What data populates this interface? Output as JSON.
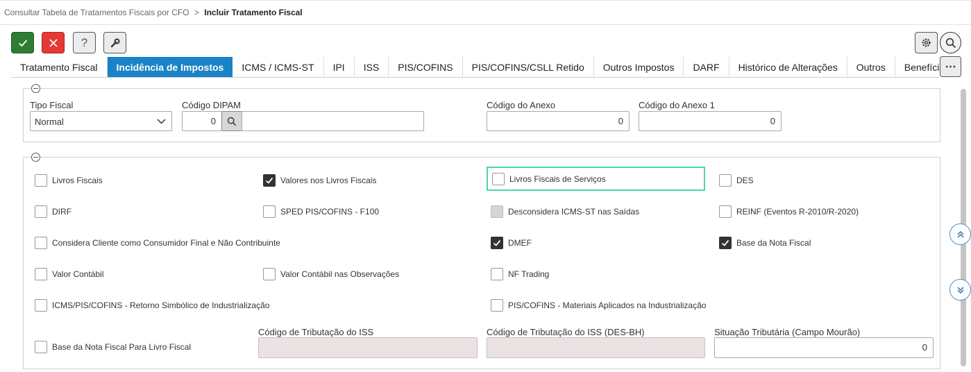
{
  "breadcrumb": {
    "parent": "Consultar Tabela de Tratamentos Fiscais por CFO",
    "separator": ">",
    "current": "Incluir Tratamento Fiscal"
  },
  "toolbar": {
    "confirm_icon": "check-icon",
    "cancel_icon": "close-icon",
    "help_label": "?",
    "tools_icon": "wrench-icon",
    "settings_icon": "gear-icon",
    "search_icon": "search-icon",
    "more_label": "⋯"
  },
  "tabs": [
    {
      "label": "Tratamento Fiscal",
      "active": false
    },
    {
      "label": "Incidência de Impostos",
      "active": true
    },
    {
      "label": "ICMS / ICMS-ST",
      "active": false
    },
    {
      "label": "IPI",
      "active": false
    },
    {
      "label": "ISS",
      "active": false
    },
    {
      "label": "PIS/COFINS",
      "active": false
    },
    {
      "label": "PIS/COFINS/CSLL Retido",
      "active": false
    },
    {
      "label": "Outros Impostos",
      "active": false
    },
    {
      "label": "DARF",
      "active": false
    },
    {
      "label": "Histórico de Alterações",
      "active": false
    },
    {
      "label": "Outros",
      "active": false
    },
    {
      "label": "Benefícios",
      "active": false
    }
  ],
  "section1": {
    "tipo_fiscal": {
      "label": "Tipo Fiscal",
      "value": "Normal"
    },
    "codigo_dipam": {
      "label": "Código DIPAM",
      "value": "0",
      "description": ""
    },
    "codigo_anexo": {
      "label": "Código do Anexo",
      "value": "0"
    },
    "codigo_anexo1": {
      "label": "Código do Anexo 1",
      "value": "0"
    }
  },
  "section2": {
    "checkboxes": {
      "livros_fiscais": {
        "label": "Livros Fiscais",
        "checked": false
      },
      "valores_livros": {
        "label": "Valores nos Livros Fiscais",
        "checked": true
      },
      "livros_servicos": {
        "label": "Livros Fiscais de Serviços",
        "checked": false
      },
      "des": {
        "label": "DES",
        "checked": false
      },
      "dirf": {
        "label": "DIRF",
        "checked": false
      },
      "sped_f100": {
        "label": "SPED PIS/COFINS - F100",
        "checked": false
      },
      "desconsidera_icms_st": {
        "label": "Desconsidera ICMS-ST nas Saídas",
        "checked": false,
        "disabled": true
      },
      "reinf": {
        "label": "REINF (Eventos R-2010/R-2020)",
        "checked": false
      },
      "consumidor_final": {
        "label": "Considera Cliente como Consumidor Final e Não Contribuinte",
        "checked": false
      },
      "dmef": {
        "label": "DMEF",
        "checked": true
      },
      "base_nota_fiscal": {
        "label": "Base da Nota Fiscal",
        "checked": true
      },
      "valor_contabil": {
        "label": "Valor Contábil",
        "checked": false
      },
      "valor_contabil_obs": {
        "label": "Valor Contábil nas Observações",
        "checked": false
      },
      "nf_trading": {
        "label": "NF Trading",
        "checked": false
      },
      "retorno_simbolico": {
        "label": "ICMS/PIS/COFINS - Retorno Simbólico de Industrialização",
        "checked": false
      },
      "materiais_aplicados": {
        "label": "PIS/COFINS - Materiais Aplicados na Industrialização",
        "checked": false
      },
      "base_livro_fiscal": {
        "label": "Base da Nota Fiscal Para Livro Fiscal",
        "checked": false
      }
    },
    "codigo_tributacao_iss": {
      "label": "Código de Tributação do ISS",
      "value": ""
    },
    "codigo_tributacao_iss_desbh": {
      "label": "Código de Tributação do ISS (DES-BH)",
      "value": ""
    },
    "situacao_tributaria": {
      "label": "Situação Tributária (Campo Mourão)",
      "value": "0"
    }
  },
  "nav": {
    "up_icon": "double-chevron-up-icon",
    "down_icon": "double-chevron-down-icon"
  }
}
